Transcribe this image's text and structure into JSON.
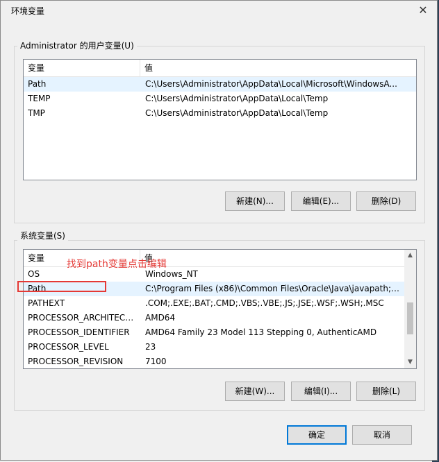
{
  "window": {
    "title": "环境变量",
    "close_glyph": "✕"
  },
  "user_vars": {
    "group_label": "Administrator 的用户变量(U)",
    "headers": {
      "name": "变量",
      "value": "值"
    },
    "rows": [
      {
        "name": "Path",
        "value": "C:\\Users\\Administrator\\AppData\\Local\\Microsoft\\WindowsA...",
        "selected": true
      },
      {
        "name": "TEMP",
        "value": "C:\\Users\\Administrator\\AppData\\Local\\Temp",
        "selected": false
      },
      {
        "name": "TMP",
        "value": "C:\\Users\\Administrator\\AppData\\Local\\Temp",
        "selected": false
      }
    ],
    "buttons": {
      "new": "新建(N)...",
      "edit": "编辑(E)...",
      "delete": "删除(D)"
    }
  },
  "system_vars": {
    "group_label": "系统变量(S)",
    "headers": {
      "name": "变量",
      "value": "值"
    },
    "rows": [
      {
        "name": "OS",
        "value": "Windows_NT",
        "selected": false
      },
      {
        "name": "Path",
        "value": "C:\\Program Files (x86)\\Common Files\\Oracle\\Java\\javapath;C:...",
        "selected": true
      },
      {
        "name": "PATHEXT",
        "value": ".COM;.EXE;.BAT;.CMD;.VBS;.VBE;.JS;.JSE;.WSF;.WSH;.MSC",
        "selected": false
      },
      {
        "name": "PROCESSOR_ARCHITECT...",
        "value": "AMD64",
        "selected": false
      },
      {
        "name": "PROCESSOR_IDENTIFIER",
        "value": "AMD64 Family 23 Model 113 Stepping 0, AuthenticAMD",
        "selected": false
      },
      {
        "name": "PROCESSOR_LEVEL",
        "value": "23",
        "selected": false
      },
      {
        "name": "PROCESSOR_REVISION",
        "value": "7100",
        "selected": false
      }
    ],
    "buttons": {
      "new": "新建(W)...",
      "edit": "编辑(I)...",
      "delete": "删除(L)"
    }
  },
  "annotation": {
    "text": "找到path变量点击编辑",
    "color": "#e53935"
  },
  "footer": {
    "ok": "确定",
    "cancel": "取消"
  },
  "colors": {
    "selection": "#e5f3ff",
    "accent": "#0078d7"
  }
}
